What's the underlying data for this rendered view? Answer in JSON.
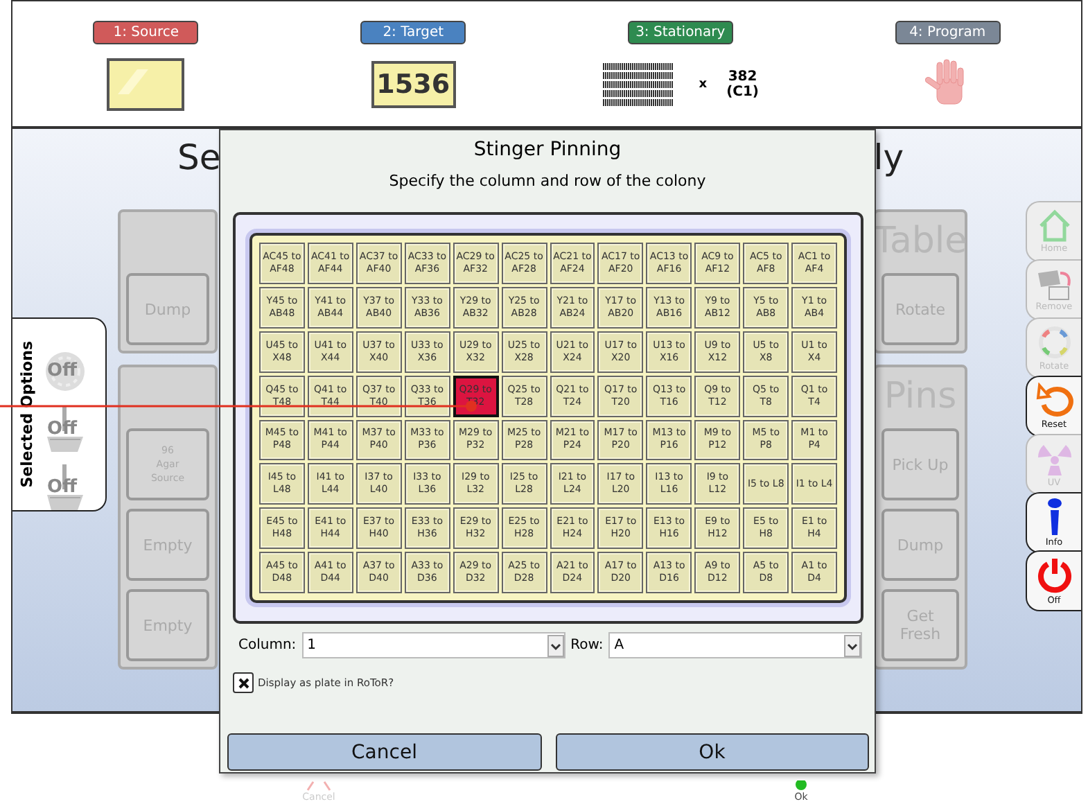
{
  "steps": [
    {
      "label": "1: Source",
      "color": "#d05a5a",
      "kind": "plate"
    },
    {
      "label": "2: Target",
      "color": "#4a82c0",
      "kind": "plate_number",
      "plate_text": "1536"
    },
    {
      "label": "3: Stationary",
      "color": "#2e8b50",
      "kind": "pins",
      "multiplier": "x",
      "count": "382",
      "count_note": "(C1)"
    },
    {
      "label": "4: Program",
      "color": "#7b8796",
      "kind": "hand"
    }
  ],
  "heading_left": "Se",
  "heading_right": "ly",
  "selected_options": {
    "title": "Selected Options",
    "items": [
      {
        "kind": "stamp",
        "label": "Off"
      },
      {
        "kind": "pin",
        "label": "Off"
      },
      {
        "kind": "pin",
        "label": "Off"
      }
    ]
  },
  "left_panels": [
    {
      "buttons": [
        {
          "label": "Dump",
          "kind": "normal"
        }
      ]
    },
    {
      "buttons": [
        {
          "label": "96 Agar Source",
          "kind": "small"
        },
        {
          "label": "Empty",
          "kind": "normal"
        },
        {
          "label": "Empty",
          "kind": "normal"
        }
      ]
    }
  ],
  "right_panels": [
    {
      "title": "Table",
      "buttons": [
        {
          "label": "Rotate",
          "kind": "normal"
        }
      ]
    },
    {
      "title": "Pins",
      "buttons": [
        {
          "label": "Pick Up",
          "kind": "normal"
        },
        {
          "label": "Dump",
          "kind": "normal"
        },
        {
          "label": "Get Fresh",
          "kind": "normal"
        }
      ]
    }
  ],
  "toolbar": [
    {
      "kind": "home",
      "label": "Home",
      "disabled": true
    },
    {
      "kind": "remove",
      "label": "Remove",
      "disabled": true
    },
    {
      "kind": "rotate",
      "label": "Rotate",
      "disabled": true
    },
    {
      "kind": "reset",
      "label": "Reset",
      "disabled": false
    },
    {
      "kind": "uv",
      "label": "UV",
      "disabled": true
    },
    {
      "kind": "info",
      "label": "Info",
      "disabled": false
    },
    {
      "kind": "power",
      "label": "Off",
      "disabled": false
    }
  ],
  "bottom_bar": [
    {
      "kind": "cancel",
      "label": "Cancel"
    },
    {
      "kind": "ok",
      "label": "Ok"
    }
  ],
  "dialog": {
    "title": "Stinger Pinning",
    "subtitle": "Specify the column and row of the colony",
    "grid": [
      [
        {
          "label": "AC45 to AF48",
          "selected": false
        },
        {
          "label": "AC41 to AF44",
          "selected": false
        },
        {
          "label": "AC37 to AF40",
          "selected": false
        },
        {
          "label": "AC33 to AF36",
          "selected": false
        },
        {
          "label": "AC29 to AF32",
          "selected": false
        },
        {
          "label": "AC25 to AF28",
          "selected": false
        },
        {
          "label": "AC21 to AF24",
          "selected": false
        },
        {
          "label": "AC17 to AF20",
          "selected": false
        },
        {
          "label": "AC13 to AF16",
          "selected": false
        },
        {
          "label": "AC9 to AF12",
          "selected": false
        },
        {
          "label": "AC5 to AF8",
          "selected": false
        },
        {
          "label": "AC1 to AF4",
          "selected": false
        }
      ],
      [
        {
          "label": "Y45 to AB48",
          "selected": false
        },
        {
          "label": "Y41 to AB44",
          "selected": false
        },
        {
          "label": "Y37 to AB40",
          "selected": false
        },
        {
          "label": "Y33 to AB36",
          "selected": false
        },
        {
          "label": "Y29 to AB32",
          "selected": false
        },
        {
          "label": "Y25 to AB28",
          "selected": false
        },
        {
          "label": "Y21 to AB24",
          "selected": false
        },
        {
          "label": "Y17 to AB20",
          "selected": false
        },
        {
          "label": "Y13 to AB16",
          "selected": false
        },
        {
          "label": "Y9 to AB12",
          "selected": false
        },
        {
          "label": "Y5 to AB8",
          "selected": false
        },
        {
          "label": "Y1 to AB4",
          "selected": false
        }
      ],
      [
        {
          "label": "U45 to X48",
          "selected": false
        },
        {
          "label": "U41 to X44",
          "selected": false
        },
        {
          "label": "U37 to X40",
          "selected": false
        },
        {
          "label": "U33 to X36",
          "selected": false
        },
        {
          "label": "U29 to X32",
          "selected": false
        },
        {
          "label": "U25 to X28",
          "selected": false
        },
        {
          "label": "U21 to X24",
          "selected": false
        },
        {
          "label": "U17 to X20",
          "selected": false
        },
        {
          "label": "U13 to X16",
          "selected": false
        },
        {
          "label": "U9 to X12",
          "selected": false
        },
        {
          "label": "U5 to X8",
          "selected": false
        },
        {
          "label": "U1 to X4",
          "selected": false
        }
      ],
      [
        {
          "label": "Q45 to T48",
          "selected": false
        },
        {
          "label": "Q41 to T44",
          "selected": false
        },
        {
          "label": "Q37 to T40",
          "selected": false
        },
        {
          "label": "Q33 to T36",
          "selected": false
        },
        {
          "label": "Q29 to T32",
          "selected": true
        },
        {
          "label": "Q25 to T28",
          "selected": false
        },
        {
          "label": "Q21 to T24",
          "selected": false
        },
        {
          "label": "Q17 to T20",
          "selected": false
        },
        {
          "label": "Q13 to T16",
          "selected": false
        },
        {
          "label": "Q9 to T12",
          "selected": false
        },
        {
          "label": "Q5 to T8",
          "selected": false
        },
        {
          "label": "Q1 to T4",
          "selected": false
        }
      ],
      [
        {
          "label": "M45 to P48",
          "selected": false
        },
        {
          "label": "M41 to P44",
          "selected": false
        },
        {
          "label": "M37 to P40",
          "selected": false
        },
        {
          "label": "M33 to P36",
          "selected": false
        },
        {
          "label": "M29 to P32",
          "selected": false
        },
        {
          "label": "M25 to P28",
          "selected": false
        },
        {
          "label": "M21 to P24",
          "selected": false
        },
        {
          "label": "M17 to P20",
          "selected": false
        },
        {
          "label": "M13 to P16",
          "selected": false
        },
        {
          "label": "M9 to P12",
          "selected": false
        },
        {
          "label": "M5 to P8",
          "selected": false
        },
        {
          "label": "M1 to P4",
          "selected": false
        }
      ],
      [
        {
          "label": "I45 to L48",
          "selected": false
        },
        {
          "label": "I41 to L44",
          "selected": false
        },
        {
          "label": "I37 to L40",
          "selected": false
        },
        {
          "label": "I33 to L36",
          "selected": false
        },
        {
          "label": "I29 to L32",
          "selected": false
        },
        {
          "label": "I25 to L28",
          "selected": false
        },
        {
          "label": "I21 to L24",
          "selected": false
        },
        {
          "label": "I17 to L20",
          "selected": false
        },
        {
          "label": "I13 to L16",
          "selected": false
        },
        {
          "label": "I9 to L12",
          "selected": false
        },
        {
          "label": "I5 to L8",
          "selected": false
        },
        {
          "label": "I1 to L4",
          "selected": false
        }
      ],
      [
        {
          "label": "E45 to H48",
          "selected": false
        },
        {
          "label": "E41 to H44",
          "selected": false
        },
        {
          "label": "E37 to H40",
          "selected": false
        },
        {
          "label": "E33 to H36",
          "selected": false
        },
        {
          "label": "E29 to H32",
          "selected": false
        },
        {
          "label": "E25 to H28",
          "selected": false
        },
        {
          "label": "E21 to H24",
          "selected": false
        },
        {
          "label": "E17 to H20",
          "selected": false
        },
        {
          "label": "E13 to H16",
          "selected": false
        },
        {
          "label": "E9 to H12",
          "selected": false
        },
        {
          "label": "E5 to H8",
          "selected": false
        },
        {
          "label": "E1 to H4",
          "selected": false
        }
      ],
      [
        {
          "label": "A45 to D48",
          "selected": false
        },
        {
          "label": "A41 to D44",
          "selected": false
        },
        {
          "label": "A37 to D40",
          "selected": false
        },
        {
          "label": "A33 to D36",
          "selected": false
        },
        {
          "label": "A29 to D32",
          "selected": false
        },
        {
          "label": "A25 to D28",
          "selected": false
        },
        {
          "label": "A21 to D24",
          "selected": false
        },
        {
          "label": "A17 to D20",
          "selected": false
        },
        {
          "label": "A13 to D16",
          "selected": false
        },
        {
          "label": "A9 to D12",
          "selected": false
        },
        {
          "label": "A5 to D8",
          "selected": false
        },
        {
          "label": "A1 to D4",
          "selected": false
        }
      ]
    ],
    "column_label": "Column:",
    "column_value": "1",
    "row_label": "Row:",
    "row_value": "A",
    "display_checkbox": {
      "label": "Display as plate in RoToR?",
      "checked": true
    },
    "buttons": [
      "Cancel",
      "Ok"
    ]
  }
}
